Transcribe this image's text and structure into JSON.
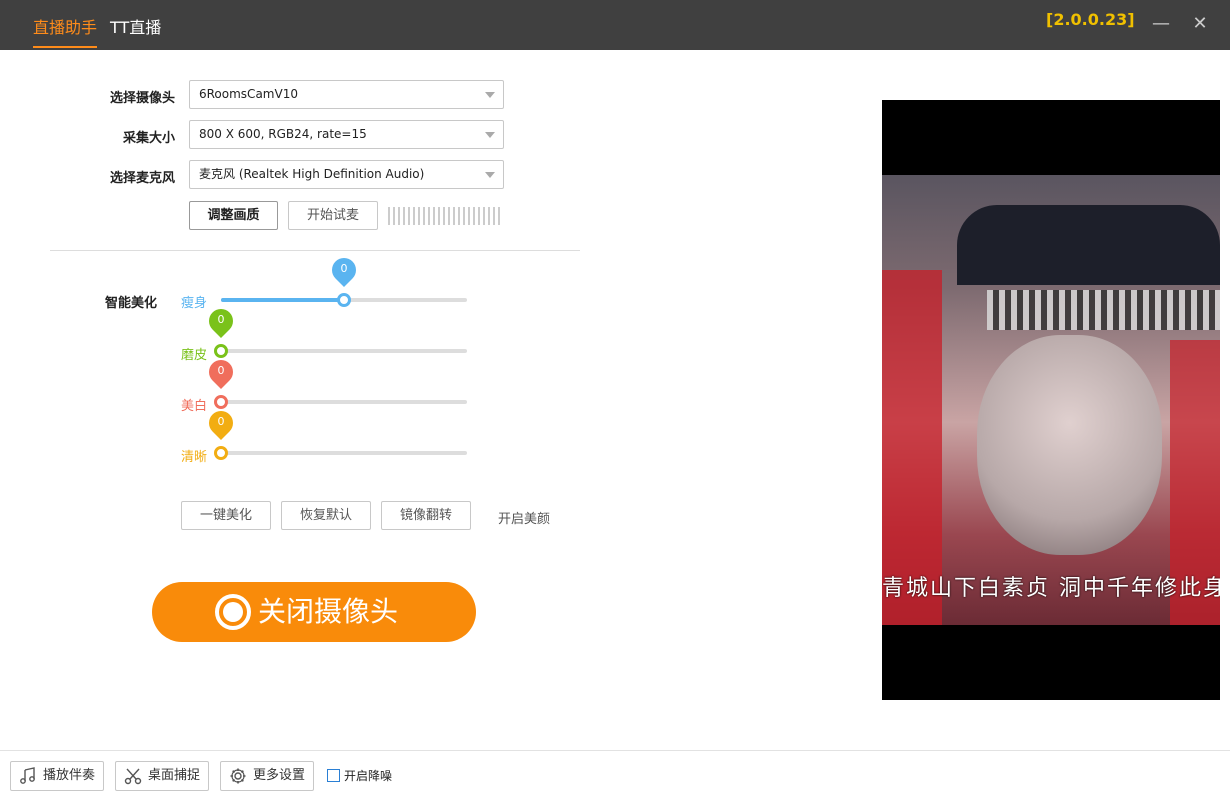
{
  "titlebar": {
    "tabs": [
      {
        "label": "直播助手",
        "active": true
      },
      {
        "label": "TT直播",
        "active": false
      }
    ],
    "version": "[2.0.0.23]",
    "minimize": "—",
    "close": "✕"
  },
  "form": {
    "camera_label": "选择摄像头",
    "camera_value": "6RoomsCamV10",
    "capture_label": "采集大小",
    "capture_value": "800 X 600, RGB24, rate=15",
    "mic_label": "选择麦克风",
    "mic_value": "麦克风 (Realtek High Definition Audio)",
    "adjust_quality": "调整画质",
    "start_mic_test": "开始试麦"
  },
  "beauty": {
    "title": "智能美化",
    "sliders": [
      {
        "label": "瘦身",
        "value": "0",
        "level": 0.5,
        "color": "#5ab4f0"
      },
      {
        "label": "磨皮",
        "value": "0",
        "level": 0.0,
        "color": "#7ac21a"
      },
      {
        "label": "美白",
        "value": "0",
        "level": 0.0,
        "color": "#f06e5c"
      },
      {
        "label": "清晰",
        "value": "0",
        "level": 0.0,
        "color": "#f2ad12"
      }
    ],
    "one_click": "一键美化",
    "restore_default": "恢复默认",
    "mirror_flip": "镜像翻转",
    "enable_beauty": "开启美颜"
  },
  "camera_toggle": "关闭摄像头",
  "preview": {
    "subtitle": "青城山下白素贞 洞中千年修此身"
  },
  "bottom": {
    "play_accompaniment": "播放伴奏",
    "desktop_capture": "桌面捕捉",
    "more_settings": "更多设置",
    "noise_reduction": "开启降噪",
    "noise_reduction_checked": false
  },
  "colors": {
    "accent": "#ff8c1a",
    "version": "#f0c000",
    "titlebar": "#404040",
    "camera_button": "#f98b0a"
  }
}
